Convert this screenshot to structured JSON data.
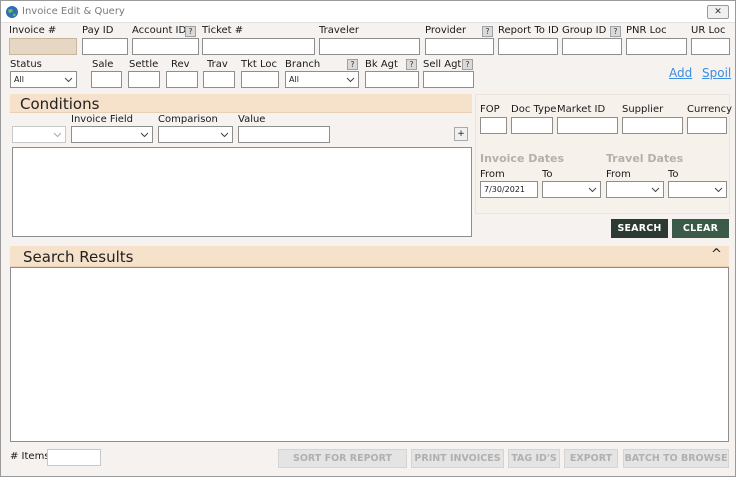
{
  "window": {
    "title": "Invoice Edit & Query",
    "close": "✕"
  },
  "top_fields": {
    "invoice": "Invoice #",
    "pay_id": "Pay ID",
    "account_id": "Account ID",
    "ticket": "Ticket #",
    "traveler": "Traveler",
    "provider": "Provider",
    "report_to_id": "Report To ID",
    "group_id": "Group ID",
    "pnr_loc": "PNR Loc",
    "ur_loc": "UR Loc",
    "help": "?"
  },
  "second_row": {
    "status": "Status",
    "status_value": "All",
    "sale": "Sale",
    "settle": "Settle",
    "rev": "Rev",
    "trav": "Trav",
    "tkt_loc": "Tkt Loc",
    "branch": "Branch",
    "branch_value": "All",
    "bk_agt": "Bk Agt",
    "sell_agt": "Sell Agt",
    "add": "Add",
    "spoil": "Spoil"
  },
  "conditions": {
    "title": "Conditions",
    "invoice_field": "Invoice Field",
    "comparison": "Comparison",
    "value": "Value",
    "plus": "+"
  },
  "right_panel": {
    "fop": "FOP",
    "doc_type": "Doc Type",
    "market_id": "Market ID",
    "supplier": "Supplier",
    "currency": "Currency",
    "invoice_dates": "Invoice Dates",
    "travel_dates": "Travel Dates",
    "from": "From",
    "to": "To",
    "invoice_from_value": "7/30/2021"
  },
  "actions": {
    "search": "SEARCH",
    "clear": "CLEAR",
    "search_color": "#2b3a33",
    "clear_color": "#3b5a48"
  },
  "results": {
    "title": "Search Results",
    "collapse": "^"
  },
  "footer": {
    "items_label": "# Items",
    "sort_for_report": "SORT FOR REPORT",
    "print_invoices": "PRINT INVOICES",
    "tag_ids": "TAG ID'S",
    "export": "EXPORT",
    "batch_to_browse": "BATCH TO BROWSE"
  }
}
